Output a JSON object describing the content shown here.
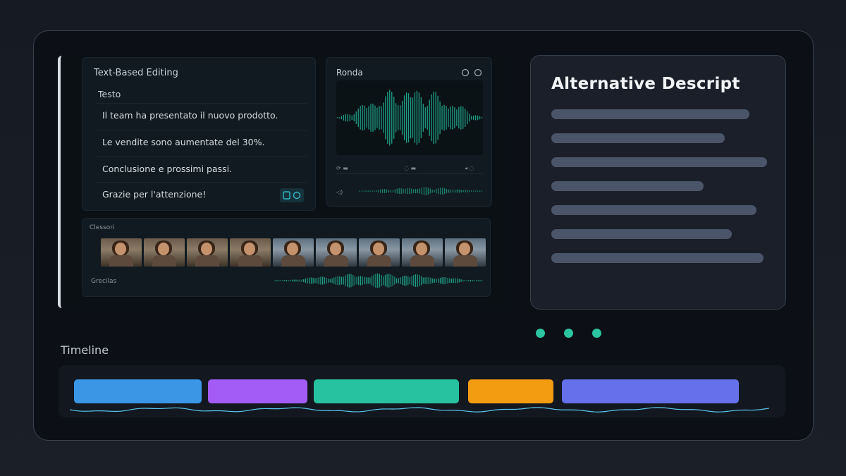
{
  "screenshot": {
    "text_panel": {
      "title": "Text-Based Editing",
      "section_label": "Testo",
      "rows": [
        "Il team ha presentato il nuovo prodotto.",
        "Le vendite sono aumentate del 30%.",
        "Conclusione e prossimi passi.",
        "Grazie per l'attenzione!"
      ]
    },
    "audio_panel": {
      "title": "Ronda"
    },
    "strip_panel": {
      "label_top": "Clessori",
      "label_bottom": "Grecilas"
    }
  },
  "card": {
    "title": "Alternative Descript"
  },
  "pagination": {
    "dots": 3,
    "color": "#2bc4a0"
  },
  "timeline": {
    "label": "Timeline",
    "clips": [
      {
        "name": "clip-blue",
        "color": "#3b96e6"
      },
      {
        "name": "clip-purple",
        "color": "#a35cf6"
      },
      {
        "name": "clip-teal",
        "color": "#27c29f"
      },
      {
        "name": "clip-orange",
        "color": "#f39c12"
      },
      {
        "name": "clip-indigo",
        "color": "#6670ea"
      }
    ],
    "waveform_color": "#5bc8ee"
  },
  "colors": {
    "accent": "#2bc4a0",
    "card_bg": "#1a1f2a",
    "skeleton": "#4b5569"
  }
}
